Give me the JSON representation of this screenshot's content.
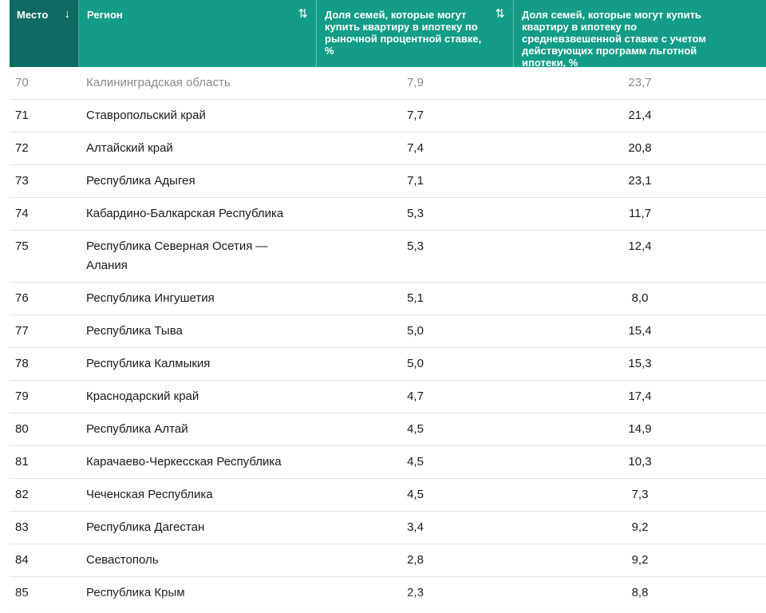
{
  "header": {
    "col_place": "Место",
    "col_place_sort": "↓",
    "col_region": "Регион",
    "col_region_sort": "⇅",
    "col_market": "Доля семей, которые могут купить квартиру в ипотеку по рыночной процентной ставке, %",
    "col_market_sort": "⇅",
    "col_preferential": "Доля семей, которые могут купить квартиру в ипотеку по средневзвешенной ставке с учетом действующих программ льготной ипотеки, %"
  },
  "rows": [
    {
      "place": "70",
      "region": "Калининградская область",
      "market": "7,9",
      "preferential": "23,7"
    },
    {
      "place": "71",
      "region": "Ставропольский край",
      "market": "7,7",
      "preferential": "21,4"
    },
    {
      "place": "72",
      "region": "Алтайский край",
      "market": "7,4",
      "preferential": "20,8"
    },
    {
      "place": "73",
      "region": "Республика Адыгея",
      "market": "7,1",
      "preferential": "23,1"
    },
    {
      "place": "74",
      "region": "Кабардино-Балкарская Республика",
      "market": "5,3",
      "preferential": "11,7"
    },
    {
      "place": "75",
      "region": "Республика Северная Осетия — Алания",
      "market": "5,3",
      "preferential": "12,4"
    },
    {
      "place": "76",
      "region": "Республика Ингушетия",
      "market": "5,1",
      "preferential": "8,0"
    },
    {
      "place": "77",
      "region": "Республика Тыва",
      "market": "5,0",
      "preferential": "15,4"
    },
    {
      "place": "78",
      "region": "Республика Калмыкия",
      "market": "5,0",
      "preferential": "15,3"
    },
    {
      "place": "79",
      "region": "Краснодарский край",
      "market": "4,7",
      "preferential": "17,4"
    },
    {
      "place": "80",
      "region": "Республика Алтай",
      "market": "4,5",
      "preferential": "14,9"
    },
    {
      "place": "81",
      "region": "Карачаево-Черкесская Республика",
      "market": "4,5",
      "preferential": "10,3"
    },
    {
      "place": "82",
      "region": "Чеченская Республика",
      "market": "4,5",
      "preferential": "7,3"
    },
    {
      "place": "83",
      "region": "Республика Дагестан",
      "market": "3,4",
      "preferential": "9,2"
    },
    {
      "place": "84",
      "region": "Севастополь",
      "market": "2,8",
      "preferential": "9,2"
    },
    {
      "place": "85",
      "region": "Республика Крым",
      "market": "2,3",
      "preferential": "8,8"
    }
  ],
  "colors": {
    "header_bg": "#139c87",
    "sorted_header_bg": "#0f6b61",
    "header_text": "#ffffff",
    "row_border": "#e3e3e3"
  }
}
